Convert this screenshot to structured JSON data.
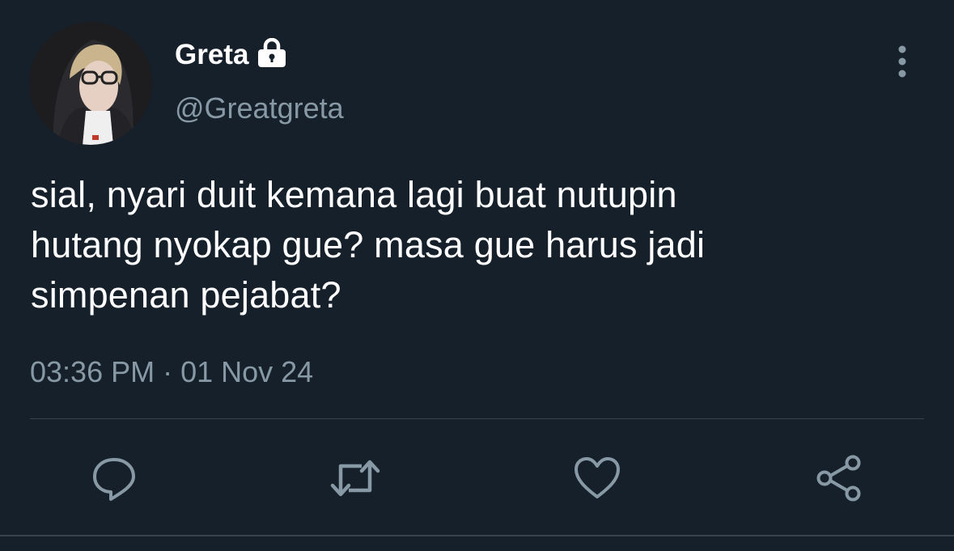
{
  "tweet": {
    "display_name": "Greta",
    "handle": "@Greatgreta",
    "text_lines": [
      "sial, nyari duit kemana lagi buat nutupin",
      "hutang nyokap gue? masa gue harus jadi",
      "simpenan pejabat?"
    ],
    "timestamp": "03:36 PM · 01 Nov 24"
  },
  "icons": {
    "account": "lock-icon",
    "menu": "more-vertical-icon",
    "actions": [
      "reply-icon",
      "retweet-icon",
      "like-icon",
      "share-icon"
    ]
  },
  "colors": {
    "background": "#15202b",
    "primary_text": "#ffffff",
    "secondary_text": "#8899a6",
    "divider": "#38444d"
  }
}
